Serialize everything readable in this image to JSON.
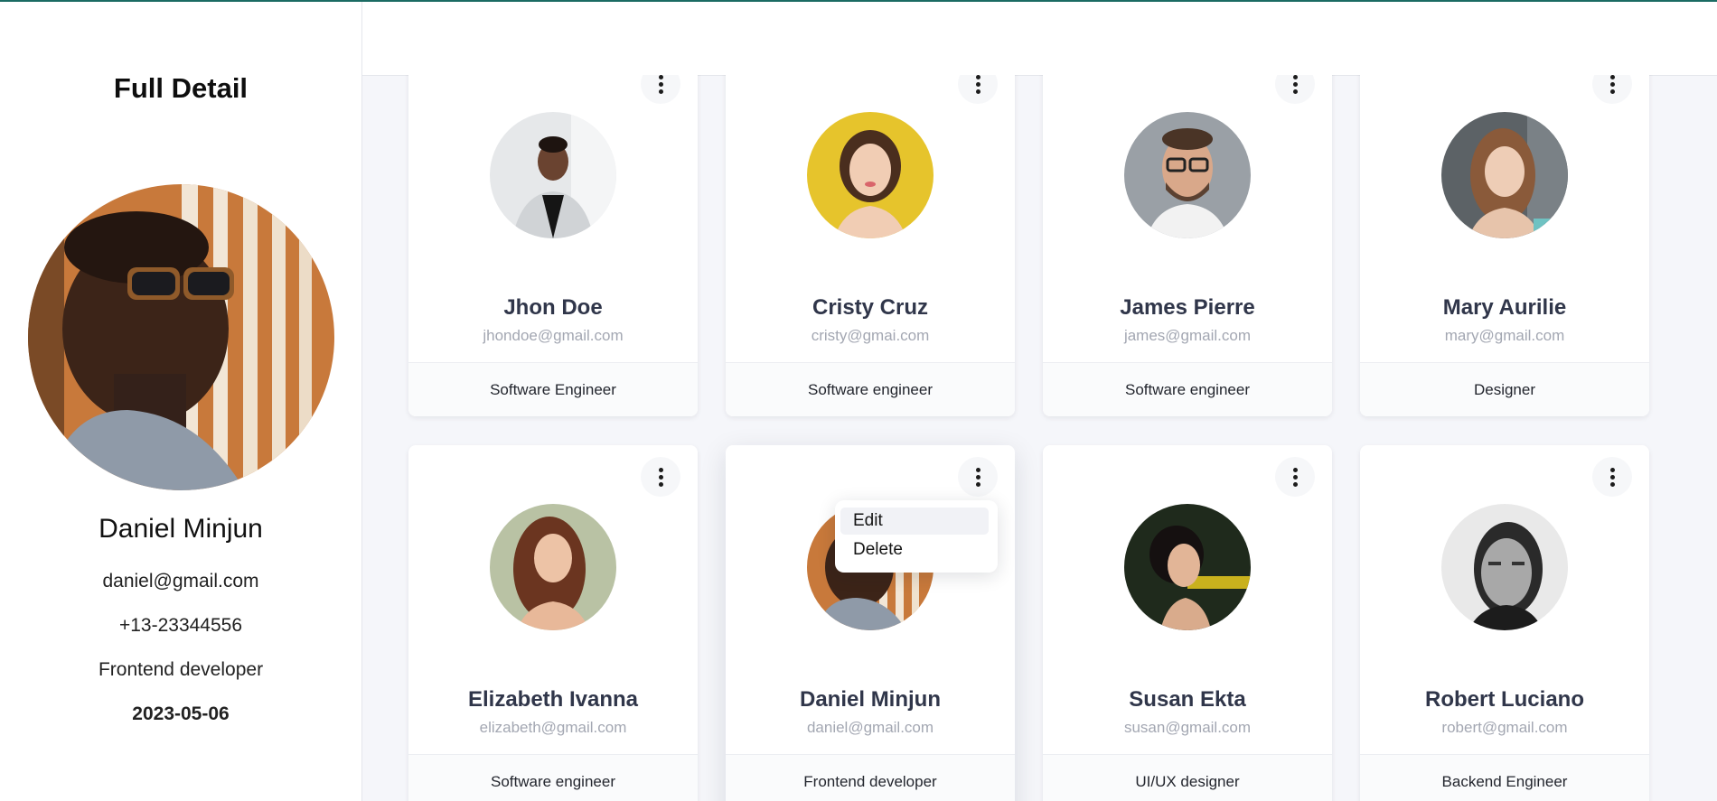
{
  "sidebar": {
    "title": "Full Detail",
    "profile": {
      "name": "Daniel Minjun",
      "email": "daniel@gmail.com",
      "phone": "+13-23344556",
      "role": "Frontend developer",
      "date": "2023-05-06"
    }
  },
  "cards": [
    {
      "name": "Jhon Doe",
      "email": "jhondoe@gmail.com",
      "role": "Software Engineer"
    },
    {
      "name": "Cristy Cruz",
      "email": "cristy@gmai.com",
      "role": "Software engineer"
    },
    {
      "name": "James Pierre",
      "email": "james@gmail.com",
      "role": "Software engineer"
    },
    {
      "name": "Mary Aurilie",
      "email": "mary@gmail.com",
      "role": "Designer"
    },
    {
      "name": "Elizabeth Ivanna",
      "email": "elizabeth@gmail.com",
      "role": "Software engineer"
    },
    {
      "name": "Daniel Minjun",
      "email": "daniel@gmail.com",
      "role": "Frontend developer"
    },
    {
      "name": "Susan Ekta",
      "email": "susan@gmail.com",
      "role": "UI/UX designer"
    },
    {
      "name": "Robert Luciano",
      "email": "robert@gmail.com",
      "role": "Backend Engineer"
    }
  ],
  "context_menu": {
    "edit_label": "Edit",
    "delete_label": "Delete"
  },
  "colors": {
    "accent": "#1b6b63",
    "name_text": "#30364a",
    "email_text": "#a3a7b2",
    "background": "#f5f6fa"
  }
}
